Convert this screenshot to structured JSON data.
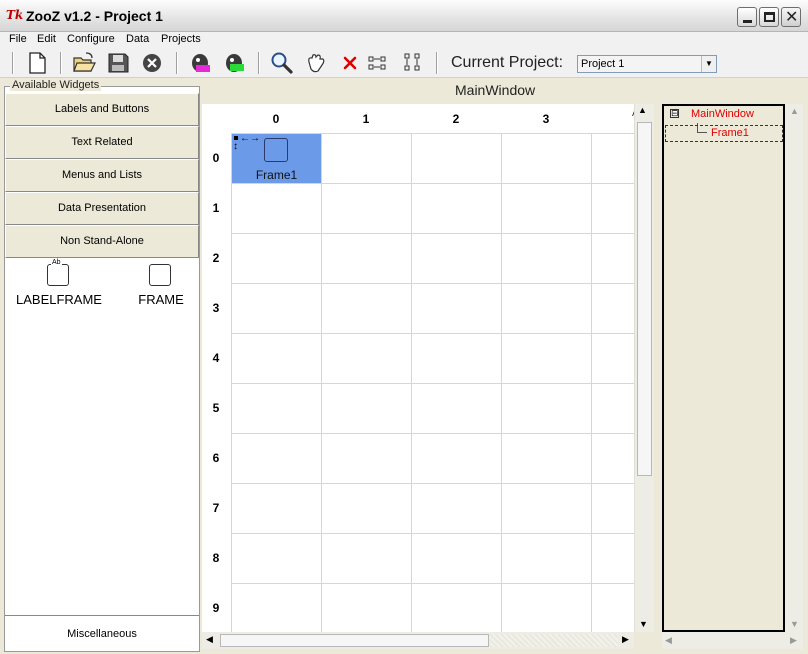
{
  "window": {
    "logo_text": "Tk",
    "title": "ZooZ v1.2 - Project 1"
  },
  "menu": {
    "items": [
      "File",
      "Edit",
      "Configure",
      "Data",
      "Projects"
    ]
  },
  "toolbar": {
    "current_project_label": "Current Project:",
    "current_project_value": "Project 1",
    "dropdown_arrow": "▼"
  },
  "left_panel": {
    "title": "Available Widgets",
    "categories": [
      "Labels and Buttons",
      "Text Related",
      "Menus and Lists",
      "Data Presentation",
      "Non Stand-Alone"
    ],
    "widgets": [
      {
        "name": "LABELFRAME",
        "icon": "labelframe-icon",
        "icon_text": "Ab"
      },
      {
        "name": "FRAME",
        "icon": "frame-icon"
      }
    ],
    "misc_label": "Miscellaneous"
  },
  "designer": {
    "window_title": "MainWindow",
    "columns": [
      "0",
      "1",
      "2",
      "3"
    ],
    "rows": [
      "0",
      "1",
      "2",
      "3",
      "4",
      "5",
      "6",
      "7",
      "8",
      "9"
    ],
    "clipped_glyph": "A",
    "selected_widget": {
      "label": "Frame1",
      "row": 0,
      "column": 0,
      "color": "#6b9be8",
      "handle_h": "←→",
      "handle_v": "↕"
    }
  },
  "tree": {
    "expander": "⊟",
    "root": "MainWindow",
    "child": "Frame1",
    "label_color": "#e00000"
  },
  "scroll": {
    "up": "▲",
    "down": "▼",
    "left": "◀",
    "right": "▶"
  }
}
